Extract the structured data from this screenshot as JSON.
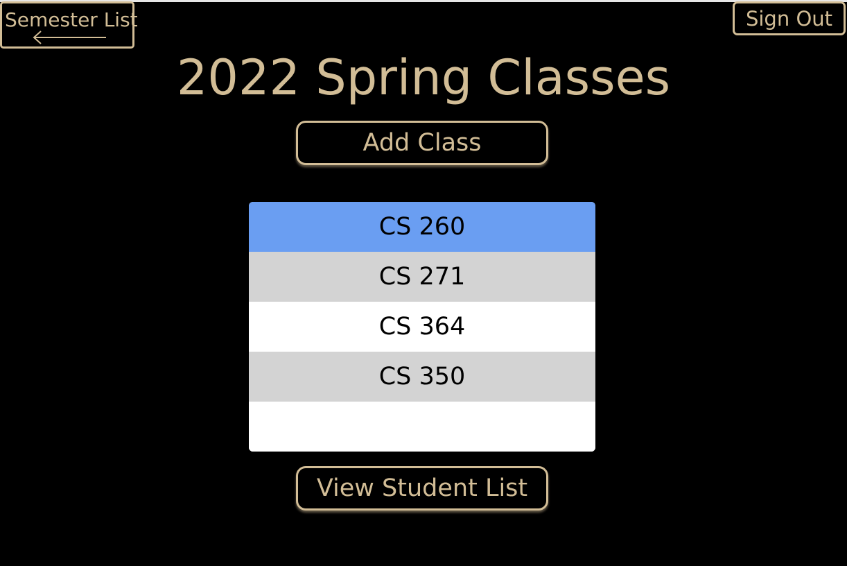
{
  "header": {
    "back_label": "Semester List",
    "back_icon": "left-arrow-icon",
    "signout_label": "Sign Out"
  },
  "page": {
    "title": "2022 Spring Classes"
  },
  "actions": {
    "add_class_label": "Add Class",
    "view_students_label": "View Student List"
  },
  "classes": {
    "items": [
      {
        "label": "CS 260",
        "selected": true
      },
      {
        "label": "CS 271",
        "selected": false
      },
      {
        "label": "CS 364",
        "selected": false
      },
      {
        "label": "CS 350",
        "selected": false
      }
    ]
  },
  "colors": {
    "background": "#000000",
    "accent_gold": "#d2bd96",
    "selected_row": "#6a9ef2",
    "alt_row": "#d3d3d3",
    "plain_row": "#ffffff"
  }
}
